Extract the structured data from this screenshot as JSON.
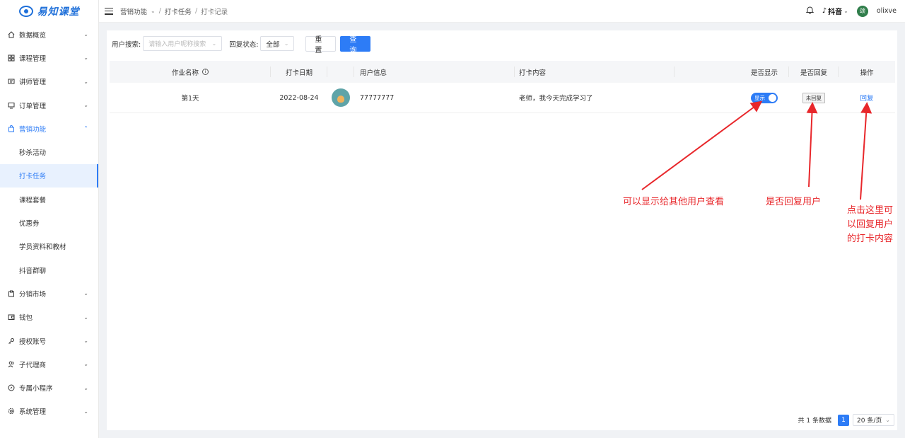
{
  "brand": {
    "name": "易知课堂"
  },
  "sidebar": {
    "items": [
      {
        "label": "数据概览",
        "icon": "home-icon"
      },
      {
        "label": "课程管理",
        "icon": "grid-icon"
      },
      {
        "label": "讲师管理",
        "icon": "id-card-icon"
      },
      {
        "label": "订单管理",
        "icon": "monitor-icon"
      },
      {
        "label": "营销功能",
        "icon": "bag-icon",
        "open": true
      },
      {
        "label": "分销市场",
        "icon": "clipboard-icon"
      },
      {
        "label": "钱包",
        "icon": "wallet-icon"
      },
      {
        "label": "授权账号",
        "icon": "key-icon"
      },
      {
        "label": "子代理商",
        "icon": "users-icon"
      },
      {
        "label": "专属小程序",
        "icon": "compass-icon"
      },
      {
        "label": "系统管理",
        "icon": "gear-icon"
      }
    ],
    "sub_items": [
      "秒杀活动",
      "打卡任务",
      "课程套餐",
      "优惠券",
      "学员资料和教材",
      "抖音群聊"
    ],
    "active_sub": "打卡任务"
  },
  "header": {
    "breadcrumb": [
      "营销功能",
      "打卡任务",
      "打卡记录"
    ],
    "platform": "抖音",
    "avatar_text": "颂",
    "username": "olixve"
  },
  "filters": {
    "user_search_label": "用户搜索:",
    "user_search_placeholder": "请输入用户昵称搜索",
    "reply_status_label": "回复状态:",
    "reply_status_value": "全部",
    "reset_label": "重 置",
    "query_label": "查 询"
  },
  "table": {
    "columns": [
      "作业名称",
      "打卡日期",
      "",
      "用户信息",
      "打卡内容",
      "",
      "是否显示",
      "是否回复",
      "操作"
    ],
    "rows": [
      {
        "task": "第1天",
        "date": "2022-08-24",
        "user_id": "77777777",
        "content": "老师，我今天完成学习了",
        "display_label": "显示",
        "reply_status": "未回复",
        "action": "回复"
      }
    ]
  },
  "pagination": {
    "total_text": "共 1 条数据",
    "current_page": "1",
    "page_size": "20 条/页"
  },
  "annotations": {
    "display_note": "可以显示给其他用户查看",
    "reply_note": "是否回复用户",
    "action_note_line1": "点击这里可",
    "action_note_line2": "以回复用户",
    "action_note_line3": "的打卡内容",
    "color": "#e8272b"
  }
}
